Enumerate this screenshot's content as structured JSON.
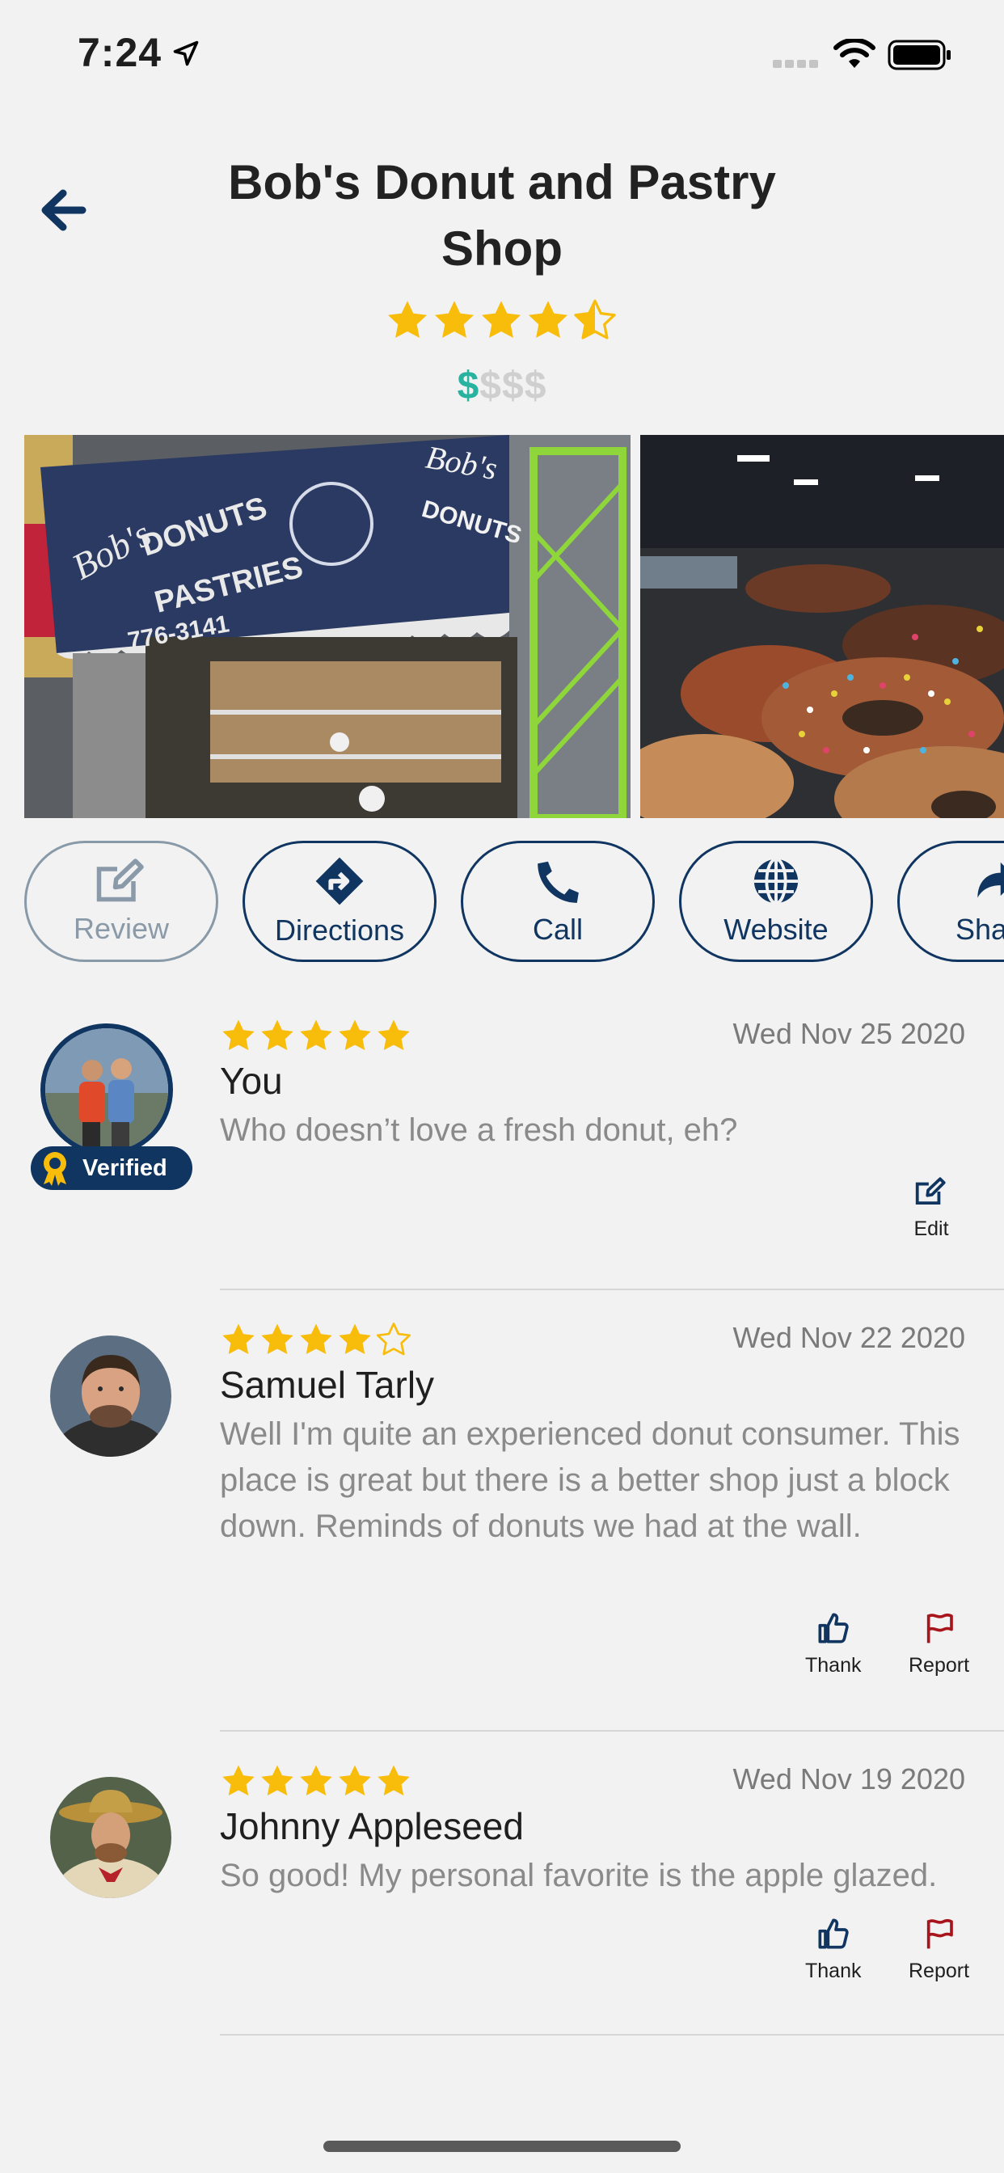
{
  "status": {
    "time": "7:24"
  },
  "header": {
    "title": "Bob's Donut and Pastry Shop",
    "rating": 4.5,
    "price_active": "$",
    "price_inactive": "$$$"
  },
  "actions": [
    {
      "label": "Review",
      "icon": "edit-icon",
      "enabled": false
    },
    {
      "label": "Directions",
      "icon": "directions-icon",
      "enabled": true
    },
    {
      "label": "Call",
      "icon": "phone-icon",
      "enabled": true
    },
    {
      "label": "Website",
      "icon": "globe-icon",
      "enabled": true
    },
    {
      "label": "Share",
      "icon": "share-icon",
      "enabled": true
    }
  ],
  "reviews": [
    {
      "name": "You",
      "rating": 5,
      "date": "Wed Nov 25 2020",
      "text": "Who doesn’t love a fresh donut, eh?",
      "verified_label": "Verified",
      "edit_label": "Edit"
    },
    {
      "name": "Samuel Tarly",
      "rating": 4,
      "date": "Wed Nov 22 2020",
      "text": "Well I'm quite an experienced donut consumer. This place is great but there is a better shop just a block down. Reminds of donuts we had at the wall.",
      "thank_label": "Thank",
      "report_label": "Report"
    },
    {
      "name": "Johnny Appleseed",
      "rating": 5,
      "date": "Wed Nov 19 2020",
      "text": "So good! My personal favorite is the apple glazed.",
      "thank_label": "Thank",
      "report_label": "Report"
    }
  ],
  "colors": {
    "brand_navy": "#0f3560",
    "star_gold": "#f8bc0a",
    "price_teal": "#27b3a0",
    "report_red": "#a8141c"
  }
}
